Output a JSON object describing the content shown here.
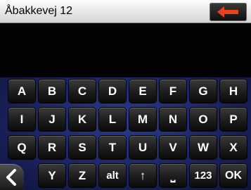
{
  "input": {
    "value": "Åbakkevej 12",
    "back_icon": "arrow-left-icon",
    "back_icon_color": "#e8421e"
  },
  "keyboard": {
    "row1": [
      "A",
      "B",
      "C",
      "D",
      "E",
      "F",
      "G",
      "H"
    ],
    "row2": [
      "I",
      "J",
      "K",
      "L",
      "M",
      "N",
      "O",
      "P"
    ],
    "row3": [
      "Q",
      "R",
      "S",
      "T",
      "U",
      "V",
      "W",
      "X"
    ],
    "row4": {
      "y": "Y",
      "z": "Z",
      "alt": "alt",
      "shift_symbol": "↑",
      "space_symbol": "⎵",
      "numeric": "123",
      "ok": "OK"
    },
    "scroll_icon": "chevron-left-icon"
  },
  "colors": {
    "keyboard_background": "#1b2462",
    "key": "#1f1f1f",
    "key_text": "#ffffff"
  }
}
